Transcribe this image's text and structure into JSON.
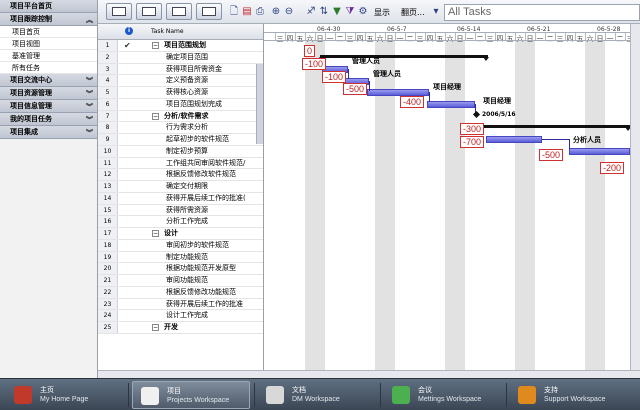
{
  "sidebar": {
    "top": "项目平台首页",
    "sections": [
      {
        "label": "项目跟踪控制",
        "items": [
          "项目首页",
          "项目视图",
          "基准管理",
          "所有任务"
        ]
      },
      {
        "label": "项目交流中心",
        "items": []
      },
      {
        "label": "项目资源管理",
        "items": []
      },
      {
        "label": "项目信息管理",
        "items": []
      },
      {
        "label": "我的项目任务",
        "items": []
      },
      {
        "label": "项目集成",
        "items": []
      }
    ]
  },
  "toolbar": {
    "show_label": "显示",
    "page_label": "翻页...",
    "search_placeholder": "All Tasks"
  },
  "grid": {
    "task_name_header": "Task Name",
    "info_glyph": "i",
    "tasks": [
      {
        "num": "1",
        "name": "项目范围规划",
        "summary": true,
        "checked": true
      },
      {
        "num": "2",
        "name": "确定项目范围",
        "summary": false
      },
      {
        "num": "3",
        "name": "获得项目所需资金",
        "summary": false
      },
      {
        "num": "4",
        "name": "定义预备资源",
        "summary": false
      },
      {
        "num": "5",
        "name": "获得核心资源",
        "summary": false
      },
      {
        "num": "6",
        "name": "项目范围规划完成",
        "summary": false
      },
      {
        "num": "7",
        "name": "分析/软件需求",
        "summary": true
      },
      {
        "num": "8",
        "name": "行为需求分析",
        "summary": false
      },
      {
        "num": "9",
        "name": "起草初步的软件规范",
        "summary": false
      },
      {
        "num": "10",
        "name": "制定初步预算",
        "summary": false
      },
      {
        "num": "11",
        "name": "工作组共同审阅软件规范/",
        "summary": false
      },
      {
        "num": "12",
        "name": "根据反馈修改软件规范",
        "summary": false
      },
      {
        "num": "13",
        "name": "确定交付期限",
        "summary": false
      },
      {
        "num": "14",
        "name": "获得开展后续工作的批准(",
        "summary": false
      },
      {
        "num": "15",
        "name": "获得所需资源",
        "summary": false
      },
      {
        "num": "16",
        "name": "分析工作完成",
        "summary": false
      },
      {
        "num": "17",
        "name": "设计",
        "summary": true
      },
      {
        "num": "18",
        "name": "审阅初步的软件规范",
        "summary": false
      },
      {
        "num": "19",
        "name": "制定功能规范",
        "summary": false
      },
      {
        "num": "20",
        "name": "根据功能规范开发原型",
        "summary": false
      },
      {
        "num": "21",
        "name": "审阅功能规范",
        "summary": false
      },
      {
        "num": "22",
        "name": "根据反馈修改功能规范",
        "summary": false
      },
      {
        "num": "23",
        "name": "获得开展后续工作的批准",
        "summary": false
      },
      {
        "num": "24",
        "name": "设计工作完成",
        "summary": false
      },
      {
        "num": "25",
        "name": "开发",
        "summary": true
      }
    ]
  },
  "gantt": {
    "weeks": [
      "06-4-30",
      "06-5-7",
      "06-5-14",
      "06-5-21",
      "06-5-28"
    ],
    "prefix_days": [
      "三",
      "四",
      "五",
      "六"
    ],
    "day_cycle": [
      "日",
      "一",
      "二",
      "三",
      "四",
      "五",
      "六"
    ],
    "costs": [
      "0",
      "-100",
      "-100",
      "-500",
      "-400",
      "-300",
      "-700",
      "-500",
      "-200"
    ],
    "resources": {
      "r3": "管理人员",
      "r4": "管理人员",
      "r5": "项目经理",
      "r6": "项目经理",
      "r8": "分析人员"
    },
    "milestone_date": "2006/5/16"
  },
  "workspaces": [
    {
      "title": "主页",
      "subtitle": "My Home Page",
      "color": "#c0392b"
    },
    {
      "title": "项目",
      "subtitle": "Projects Workspace",
      "color": "#f0f0f0"
    },
    {
      "title": "文档",
      "subtitle": "DM Workspace",
      "color": "#d8d8d8"
    },
    {
      "title": "会议",
      "subtitle": "Mettings Workspace",
      "color": "#4caf50"
    },
    {
      "title": "支持",
      "subtitle": "Support Workspace",
      "color": "#e08a1e"
    }
  ]
}
